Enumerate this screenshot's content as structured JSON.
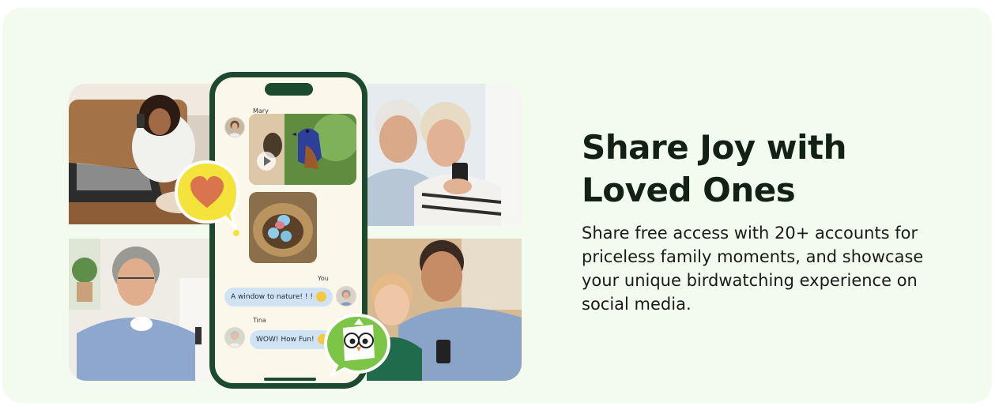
{
  "section": {
    "title": "Share Joy with Loved Ones",
    "description": "Share free access with 20+ accounts for priceless family moments, and showcase your unique birdwatching experience on social media."
  },
  "chat": {
    "messages": [
      {
        "sender": "Mary",
        "type": "media"
      },
      {
        "sender": "You",
        "text": "A window to nature! ! !",
        "emoji": "laughing-emoji"
      },
      {
        "sender": "Tina",
        "text": "WOW! How Fun!",
        "emoji": "heart-eyes-emoji"
      }
    ]
  },
  "icons": {
    "heart_badge": "heart-icon",
    "mascot_badge": "bird-mascot-icon"
  },
  "colors": {
    "background": "#f3fbee",
    "phone_frame": "#1d4a2e",
    "heading": "#122016",
    "bubble": "#cfe3f5",
    "badge_yellow": "#f4e33a",
    "heart": "#d9744e"
  }
}
